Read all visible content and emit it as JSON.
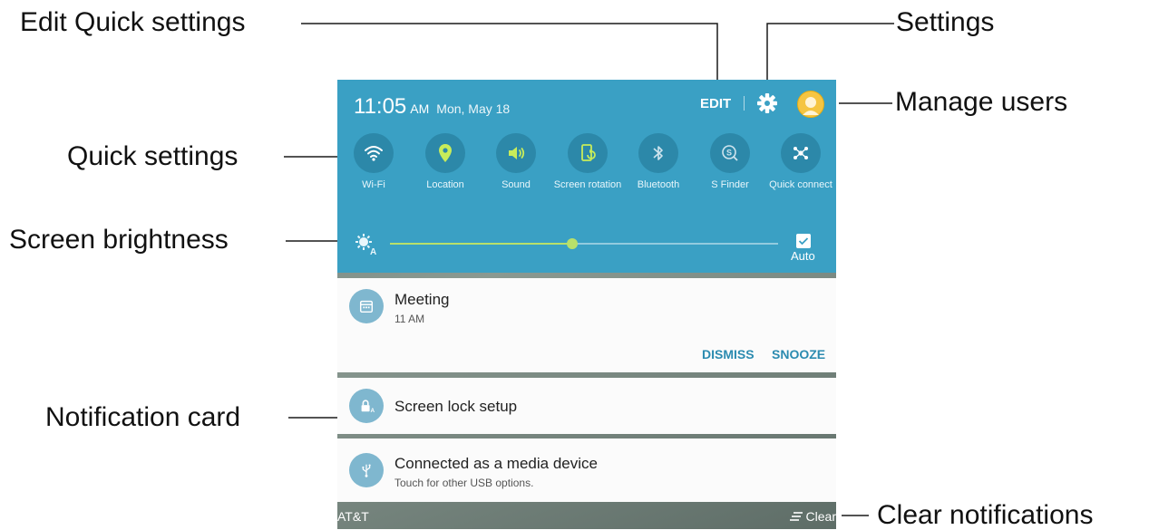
{
  "callouts": {
    "edit_quick_settings": "Edit Quick settings",
    "settings": "Settings",
    "manage_users": "Manage users",
    "quick_settings": "Quick settings",
    "screen_brightness": "Screen brightness",
    "notification_card": "Notification card",
    "clear_notifications": "Clear notifications"
  },
  "status": {
    "time": "11:05",
    "ampm": "AM",
    "date": "Mon, May 18"
  },
  "header": {
    "edit_label": "EDIT",
    "settings_icon": "gear-icon",
    "avatar_icon": "user-avatar-icon"
  },
  "quick_settings": [
    {
      "label": "Wi-Fi",
      "icon": "wifi-icon"
    },
    {
      "label": "Location",
      "icon": "location-pin-icon"
    },
    {
      "label": "Sound",
      "icon": "speaker-icon"
    },
    {
      "label": "Screen rotation",
      "icon": "screen-rotation-icon"
    },
    {
      "label": "Bluetooth",
      "icon": "bluetooth-icon"
    },
    {
      "label": "S Finder",
      "icon": "s-finder-icon"
    },
    {
      "label": "Quick connect",
      "icon": "quick-connect-icon"
    }
  ],
  "brightness": {
    "level_fraction": 0.47,
    "auto_label": "Auto",
    "auto_checked": true
  },
  "notifications": [
    {
      "title": "Meeting",
      "subtitle": "11 AM",
      "icon": "calendar-icon",
      "actions": [
        "DISMISS",
        "SNOOZE"
      ]
    },
    {
      "title": "Screen lock setup",
      "subtitle": "",
      "icon": "screen-lock-icon"
    },
    {
      "title": "Connected as a media device",
      "subtitle": "Touch for other USB options.",
      "icon": "usb-icon"
    }
  ],
  "bottom_bar": {
    "carrier": "AT&T",
    "clear_label": "Clear"
  },
  "colors": {
    "panel": "#3aa0c4",
    "tile": "#2c88a9",
    "accent": "#b8e06a",
    "action_text": "#2b8bb0"
  }
}
